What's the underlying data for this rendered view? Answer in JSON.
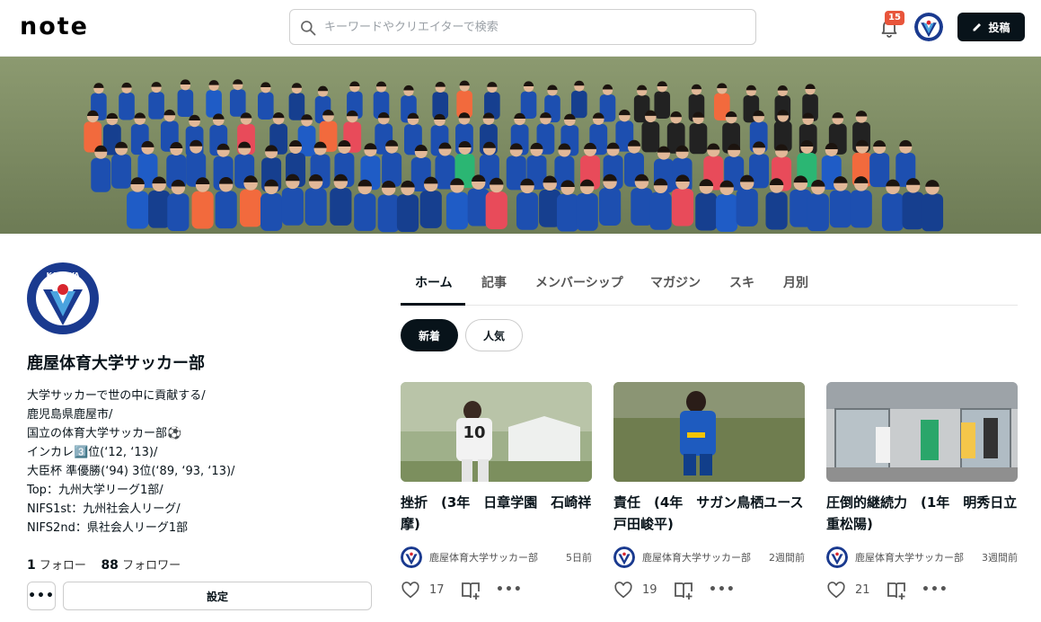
{
  "header": {
    "logo": "note",
    "search_placeholder": "キーワードやクリエイターで検索",
    "notification_count": "15",
    "post_label": "投稿"
  },
  "profile": {
    "name": "鹿屋体育大学サッカー部",
    "avatar_text": "KANOYA",
    "bio": [
      "大学サッカーで世の中に貢献する/",
      "鹿児島県鹿屋市/",
      "国立の体育大学サッカー部⚽",
      "インカレ3️⃣位(‘12, ‘13)/",
      "大臣杯 準優勝(‘94) 3位(‘89, ‘93, ‘13)/",
      "Top：九州大学リーグ1部/",
      "NIFS1st：九州社会人リーグ/",
      "NIFS2nd：県社会人リーグ1部"
    ],
    "follow_count": "1",
    "follow_label": "フォロー",
    "follower_count": "88",
    "follower_label": "フォロワー",
    "settings_label": "設定",
    "more_label": "•••"
  },
  "tabs": [
    {
      "label": "ホーム",
      "active": true
    },
    {
      "label": "記事",
      "active": false
    },
    {
      "label": "メンバーシップ",
      "active": false
    },
    {
      "label": "マガジン",
      "active": false
    },
    {
      "label": "スキ",
      "active": false
    },
    {
      "label": "月別",
      "active": false
    }
  ],
  "filters": [
    {
      "label": "新着",
      "active": true
    },
    {
      "label": "人気",
      "active": false
    }
  ],
  "cards": [
    {
      "title": "挫折　(3年　日章学園　石崎祥摩)",
      "author": "鹿屋体育大学サッカー部",
      "time": "5日前",
      "likes": "17"
    },
    {
      "title": "責任　(4年　サガン鳥栖ユース　戸田峻平)",
      "author": "鹿屋体育大学サッカー部",
      "time": "2週間前",
      "likes": "19"
    },
    {
      "title": "圧倒的継続力　(1年　明秀日立　重松陽)",
      "author": "鹿屋体育大学サッカー部",
      "time": "3週間前",
      "likes": "21"
    }
  ],
  "colors": {
    "primary": "#08131a",
    "badge": "#e8553b",
    "kanoya_blue": "#1a3a8f",
    "kanoya_red": "#d8262e"
  }
}
